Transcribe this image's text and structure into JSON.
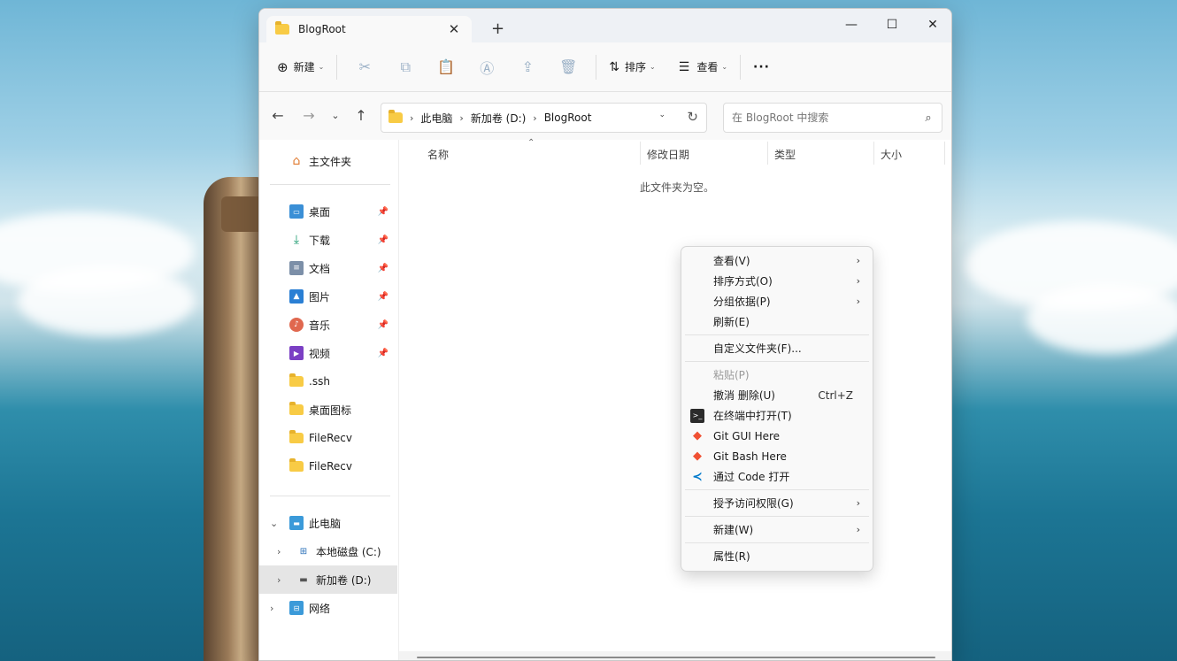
{
  "window": {
    "tab_title": "BlogRoot",
    "new_tab": "+",
    "controls": {
      "minimize": "—",
      "maximize": "☐",
      "close": "✕"
    }
  },
  "toolbar": {
    "new_label": "新建",
    "sort_label": "排序",
    "view_label": "查看",
    "more_label": "···",
    "icons": [
      "cut-icon",
      "copy-icon",
      "paste-icon",
      "rename-icon",
      "share-icon",
      "delete-icon"
    ]
  },
  "address": {
    "crumbs": [
      "此电脑",
      "新加卷 (D:)",
      "BlogRoot"
    ],
    "search_placeholder": "在 BlogRoot 中搜索"
  },
  "sidebar": {
    "home": "主文件夹",
    "pinned": [
      {
        "label": "桌面",
        "icon": "desktop-icon",
        "pinned": true
      },
      {
        "label": "下载",
        "icon": "download-icon",
        "pinned": true
      },
      {
        "label": "文档",
        "icon": "document-icon",
        "pinned": true
      },
      {
        "label": "图片",
        "icon": "pictures-icon",
        "pinned": true
      },
      {
        "label": "音乐",
        "icon": "music-icon",
        "pinned": true
      },
      {
        "label": "视频",
        "icon": "video-icon",
        "pinned": true
      },
      {
        "label": ".ssh",
        "icon": "folder-icon",
        "pinned": false
      },
      {
        "label": "桌面图标",
        "icon": "folder-icon",
        "pinned": false
      },
      {
        "label": "FileRecv",
        "icon": "folder-icon",
        "pinned": false
      },
      {
        "label": "FileRecv",
        "icon": "folder-icon",
        "pinned": false
      }
    ],
    "this_pc": "此电脑",
    "drive_c": "本地磁盘 (C:)",
    "drive_d": "新加卷 (D:)",
    "network": "网络"
  },
  "content": {
    "columns": [
      "名称",
      "修改日期",
      "类型",
      "大小"
    ],
    "empty_text": "此文件夹为空。"
  },
  "context_menu": {
    "view": "查看(V)",
    "sort": "排序方式(O)",
    "group": "分组依据(P)",
    "refresh": "刷新(E)",
    "customize": "自定义文件夹(F)...",
    "paste": "粘贴(P)",
    "undo": "撤消 删除(U)",
    "undo_shortcut": "Ctrl+Z",
    "terminal": "在终端中打开(T)",
    "git_gui": "Git GUI Here",
    "git_bash": "Git Bash Here",
    "vscode": "通过 Code 打开",
    "access": "授予访问权限(G)",
    "new": "新建(W)",
    "properties": "属性(R)"
  },
  "colors": {
    "accent": "#0067c0",
    "folder": "#f8cb45",
    "git": "#f05033",
    "vscode": "#007acc"
  }
}
